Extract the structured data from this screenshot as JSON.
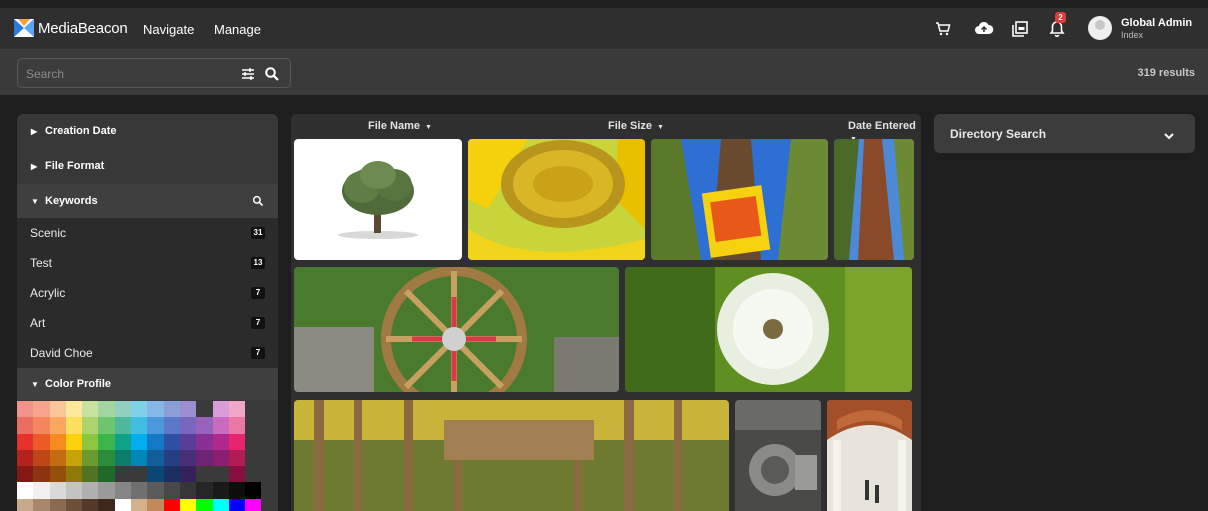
{
  "header": {
    "brand": "MediaBeacon",
    "nav": [
      "Navigate",
      "Manage"
    ],
    "icons": [
      "cart-icon",
      "upload-cloud-icon",
      "collections-icon",
      "bell-icon"
    ],
    "notification_count": "2",
    "user_name": "Global Admin",
    "user_role": "Index"
  },
  "search": {
    "placeholder": "Search",
    "results": "319 results"
  },
  "sidebar": {
    "facets": {
      "creation_date": "Creation Date",
      "file_format": "File Format",
      "keywords": "Keywords",
      "color_profile": "Color Profile"
    },
    "keywords": [
      {
        "label": "Scenic",
        "count": "31"
      },
      {
        "label": "Test",
        "count": "13"
      },
      {
        "label": "Acrylic",
        "count": "7"
      },
      {
        "label": "Art",
        "count": "7"
      },
      {
        "label": "David Choe",
        "count": "7"
      }
    ],
    "swatch_colors": [
      "#f0948a",
      "#f7a58c",
      "#fbc79a",
      "#fde89b",
      "#c8e19f",
      "#a3d5a0",
      "#8fd0bf",
      "#7fd1e8",
      "#85b8e8",
      "#8a9ed8",
      "#9a8dd0",
      "#3a3a3a",
      "#d99ed8",
      "#f1a5c8",
      "#3a3a3a",
      "#3a3a3a",
      "#ec6d62",
      "#f5875e",
      "#f9a85e",
      "#fde05e",
      "#aed36d",
      "#6ec46f",
      "#4cb99e",
      "#40bde2",
      "#4c98dc",
      "#5d77c9",
      "#7b66bf",
      "#9962bc",
      "#c96bbf",
      "#ec76a5",
      "#3a3a3a",
      "#3a3a3a",
      "#e7322c",
      "#ee5a25",
      "#f68b1f",
      "#fbd20b",
      "#8cc63f",
      "#39b54a",
      "#0ea18a",
      "#00aeef",
      "#1578c5",
      "#2e4fa3",
      "#5b3d98",
      "#8a2f93",
      "#b0278e",
      "#e8246f",
      "#3a3a3a",
      "#3a3a3a",
      "#b3221d",
      "#bf4616",
      "#c46c12",
      "#c4a40a",
      "#6d9a2f",
      "#2b8c3a",
      "#0c7d6c",
      "#0087ba",
      "#125e9b",
      "#253f82",
      "#482f78",
      "#6d2475",
      "#8a1f70",
      "#b21c56",
      "#3a3a3a",
      "#3a3a3a",
      "#851813",
      "#8e330f",
      "#935009",
      "#8f7807",
      "#527324",
      "#1f692b",
      "#3a3a3a",
      "#3a3a3a",
      "#0c4675",
      "#1c2f62",
      "#35225a",
      "#3a3a3a",
      "#3a3a3a",
      "#860f3f",
      "#3a3a3a",
      "#3a3a3a",
      "#ffffff",
      "#f0f0f0",
      "#d9d9d9",
      "#c4c4c4",
      "#b0b0b0",
      "#9a9a9a",
      "#858585",
      "#707070",
      "#5b5b5b",
      "#484848",
      "#363636",
      "#262626",
      "#1a1a1a",
      "#0d0d0d",
      "#000000",
      "#3a3a3a",
      "#c8a98a",
      "#a8876a",
      "#8a6a50",
      "#6d5039",
      "#52392a",
      "#3d281d",
      "#ffffff",
      "#d4b08c",
      "#c28a5a",
      "#ff0000",
      "#ffff00",
      "#00ff00",
      "#00ffff",
      "#0000ff",
      "#ff00ff",
      "#3a3a3a"
    ]
  },
  "gallery": {
    "sort": {
      "file_name": "File Name",
      "file_size": "File Size",
      "date_entered": "Date Entered"
    },
    "thumbnails": [
      {
        "name": "thumb-tree",
        "bg": "#ffffff"
      },
      {
        "name": "thumb-sunflower",
        "bg": "#d9b21a"
      },
      {
        "name": "thumb-no-fireworks-sign",
        "bg": "#3d7fd6"
      },
      {
        "name": "thumb-tall-tree",
        "bg": "#4b8bd6"
      },
      {
        "name": "thumb-wagon-wheel",
        "bg": "#4a6a2a"
      },
      {
        "name": "thumb-dandelion",
        "bg": "#5a8a1f"
      },
      {
        "name": "thumb-wooden-structure",
        "bg": "#8a7a3a"
      },
      {
        "name": "thumb-engine",
        "bg": "#555555"
      },
      {
        "name": "thumb-arched-walkway",
        "bg": "#a0522d"
      }
    ]
  },
  "directory": {
    "label": "Directory Search"
  }
}
